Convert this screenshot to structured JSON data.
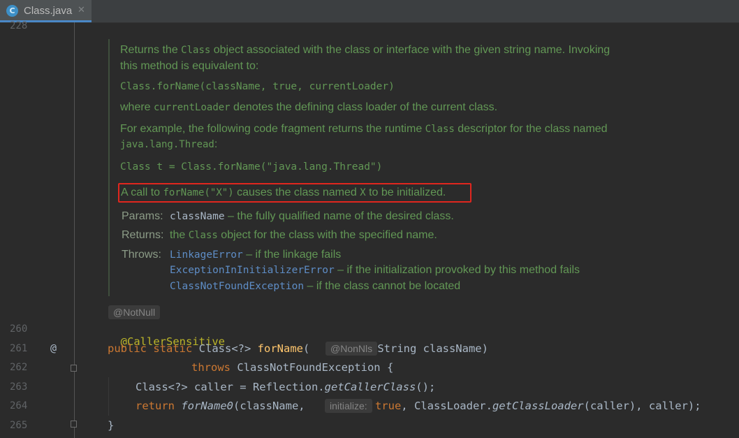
{
  "tab": {
    "icon_letter": "C",
    "label": "Class.java",
    "close": "✕"
  },
  "gutter": {
    "line_numbers": [
      "228",
      "260",
      "261",
      "262",
      "263",
      "264",
      "265"
    ],
    "marker_261": "@"
  },
  "doc": {
    "p1_line1_a": "Returns the ",
    "p1_line1_code": "Class",
    "p1_line1_b": " object associated with the class or interface with the given string name. Invoking",
    "p1_line2": "this method is equivalent to:",
    "equiv_code": "Class.forName(className, true, currentLoader)",
    "p2_a": "where ",
    "p2_code": "currentLoader",
    "p2_b": " denotes the defining class loader of the current class.",
    "p3_line1_a": "For example, the following code fragment returns the runtime ",
    "p3_line1_code": "Class",
    "p3_line1_b": " descriptor for the class named",
    "p3_line2_code": "java.lang.Thread",
    "p3_line2_b": ":",
    "example_code": "Class t = Class.forName(\"java.lang.Thread\")",
    "highlight_a": "A call to ",
    "highlight_code1": "forName(\"X\")",
    "highlight_b": " causes the class named ",
    "highlight_code2": "X",
    "highlight_c": " to be initialized.",
    "params_label": "Params:",
    "params_name": "className",
    "params_desc": " – the fully qualified name of the desired class.",
    "returns_label": "Returns:",
    "returns_a": "the ",
    "returns_code": "Class",
    "returns_b": " object for the class with the specified name.",
    "throws_label": "Throws:",
    "throws": [
      {
        "name": "LinkageError",
        "desc": " – if the linkage fails"
      },
      {
        "name": "ExceptionInInitializerError",
        "desc": " – if the initialization provoked by this method fails"
      },
      {
        "name": "ClassNotFoundException",
        "desc": " – if the class cannot be located"
      }
    ]
  },
  "hints": {
    "notnull": "@NotNull",
    "nonnls": "@NonNls",
    "initialize": "initialize:"
  },
  "code": {
    "l260": "@CallerSensitive",
    "l261_kw": "public static ",
    "l261_type": "Class<?> ",
    "l261_fn": "forName",
    "l261_paren": "(",
    "l261_rest": "String className)",
    "l262_kw": "throws ",
    "l262_rest": "ClassNotFoundException {",
    "l263_a": "Class<?> caller = Reflection.",
    "l263_it": "getCallerClass",
    "l263_b": "();",
    "l264_kw": "return ",
    "l264_it": "forName0",
    "l264_a": "(className, ",
    "l264_true": "true",
    "l264_b": ", ClassLoader.",
    "l264_it2": "getClassLoader",
    "l264_c": "(caller), caller);",
    "l265": "}"
  }
}
